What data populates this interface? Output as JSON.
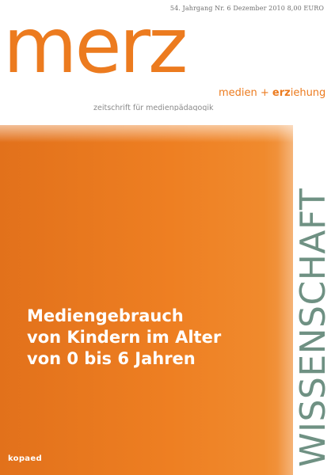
{
  "cover": {
    "issue_info": "54. Jahrgang  Nr. 6  Dezember 2010  8,00 EURO",
    "logo": "merz",
    "subbrand": {
      "part1": "medien + ",
      "part2_bold": "erz",
      "part3": "iehung"
    },
    "tagline": "zeitschrift für medienpädagogik",
    "headline_lines": [
      "Mediengebrauch",
      "von Kindern im Alter",
      "von 0 bis 6 Jahren"
    ],
    "section": "WISSENSCHAFT",
    "publisher": "kopaed"
  },
  "colors": {
    "brand_orange": "#ec7b1f",
    "section_green": "#6f9183"
  }
}
